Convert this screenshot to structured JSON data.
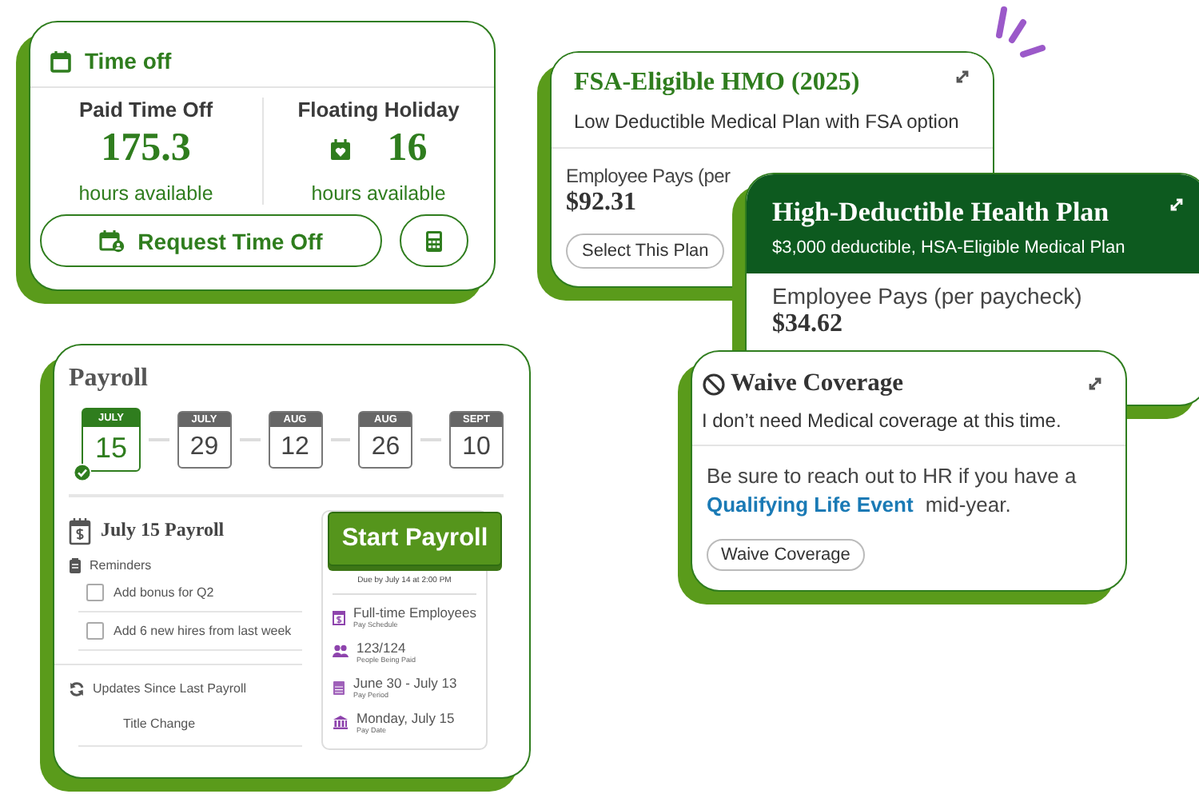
{
  "time_off": {
    "title": "Time off",
    "balances": [
      {
        "kind": "plain",
        "label": "Paid Time Off",
        "value": "175.3",
        "unit": "hours available"
      },
      {
        "kind": "holiday",
        "label": "Floating Holiday",
        "value": "16",
        "unit": "hours available"
      }
    ],
    "request_button": "Request Time Off"
  },
  "plans": [
    {
      "kind": "outline",
      "title": "FSA-Eligible HMO (2025)",
      "subtitle": "Low Deductible Medical Plan with FSA option",
      "pays_label": "Employee Pays (per",
      "amount": "$92.31",
      "button": "Select This Plan"
    },
    {
      "kind": "highlighted",
      "title": "High-Deductible Health Plan",
      "subtitle": "$3,000 deductible, HSA-Eligible Medical Plan",
      "pays_label": "Employee Pays (per paycheck)",
      "amount": "$34.62"
    }
  ],
  "waive": {
    "title": "Waive Coverage",
    "subtitle": "I don’t need Medical coverage at this time.",
    "message_before": "Be sure to reach out to HR if you have a",
    "link": "Qualifying Life Event",
    "message_after": "mid-year.",
    "button": "Waive Coverage"
  },
  "payroll": {
    "title": "Payroll",
    "dates": [
      {
        "month": "JULY",
        "day": "15",
        "selected": true
      },
      {
        "month": "JULY",
        "day": "29",
        "selected": false
      },
      {
        "month": "AUG",
        "day": "12",
        "selected": false
      },
      {
        "month": "AUG",
        "day": "26",
        "selected": false
      },
      {
        "month": "SEPT",
        "day": "10",
        "selected": false
      }
    ],
    "run_title": "July 15 Payroll",
    "reminders_label": "Reminders",
    "reminders": [
      {
        "text": "Add bonus for Q2",
        "checked": false
      },
      {
        "text": "Add 6 new hires from last week",
        "checked": false
      }
    ],
    "updates_label": "Updates Since Last Payroll",
    "updates": [
      "Title Change"
    ],
    "start_button": "Start Payroll",
    "due": "Due by July 14 at 2:00 PM",
    "details": [
      {
        "kind": "schedule",
        "value": "Full-time Employees",
        "caption": "Pay Schedule"
      },
      {
        "kind": "people",
        "value": "123/124",
        "caption": "People Being Paid"
      },
      {
        "kind": "period",
        "value": "June 30 - July 13",
        "caption": "Pay Period"
      },
      {
        "kind": "date",
        "value": "Monday, July 15",
        "caption": "Pay Date"
      }
    ]
  }
}
